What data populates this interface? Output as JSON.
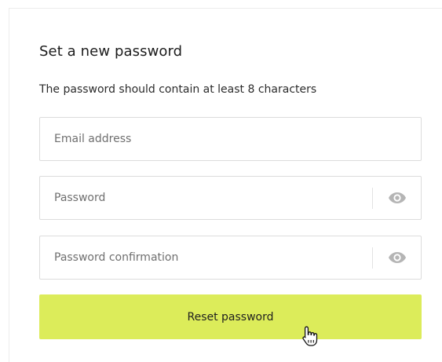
{
  "form": {
    "title": "Set a new password",
    "subtitle": "The password should contain at least 8 characters",
    "email_placeholder": "Email address",
    "password_placeholder": "Password",
    "confirm_placeholder": "Password confirmation",
    "submit_label": "Reset password"
  },
  "icons": {
    "toggle_visibility": "eye-icon",
    "pointer": "hand-pointer-icon"
  },
  "colors": {
    "button_bg": "#dcec5a",
    "border": "#dcdcdc",
    "icon": "#b5b5b5"
  }
}
